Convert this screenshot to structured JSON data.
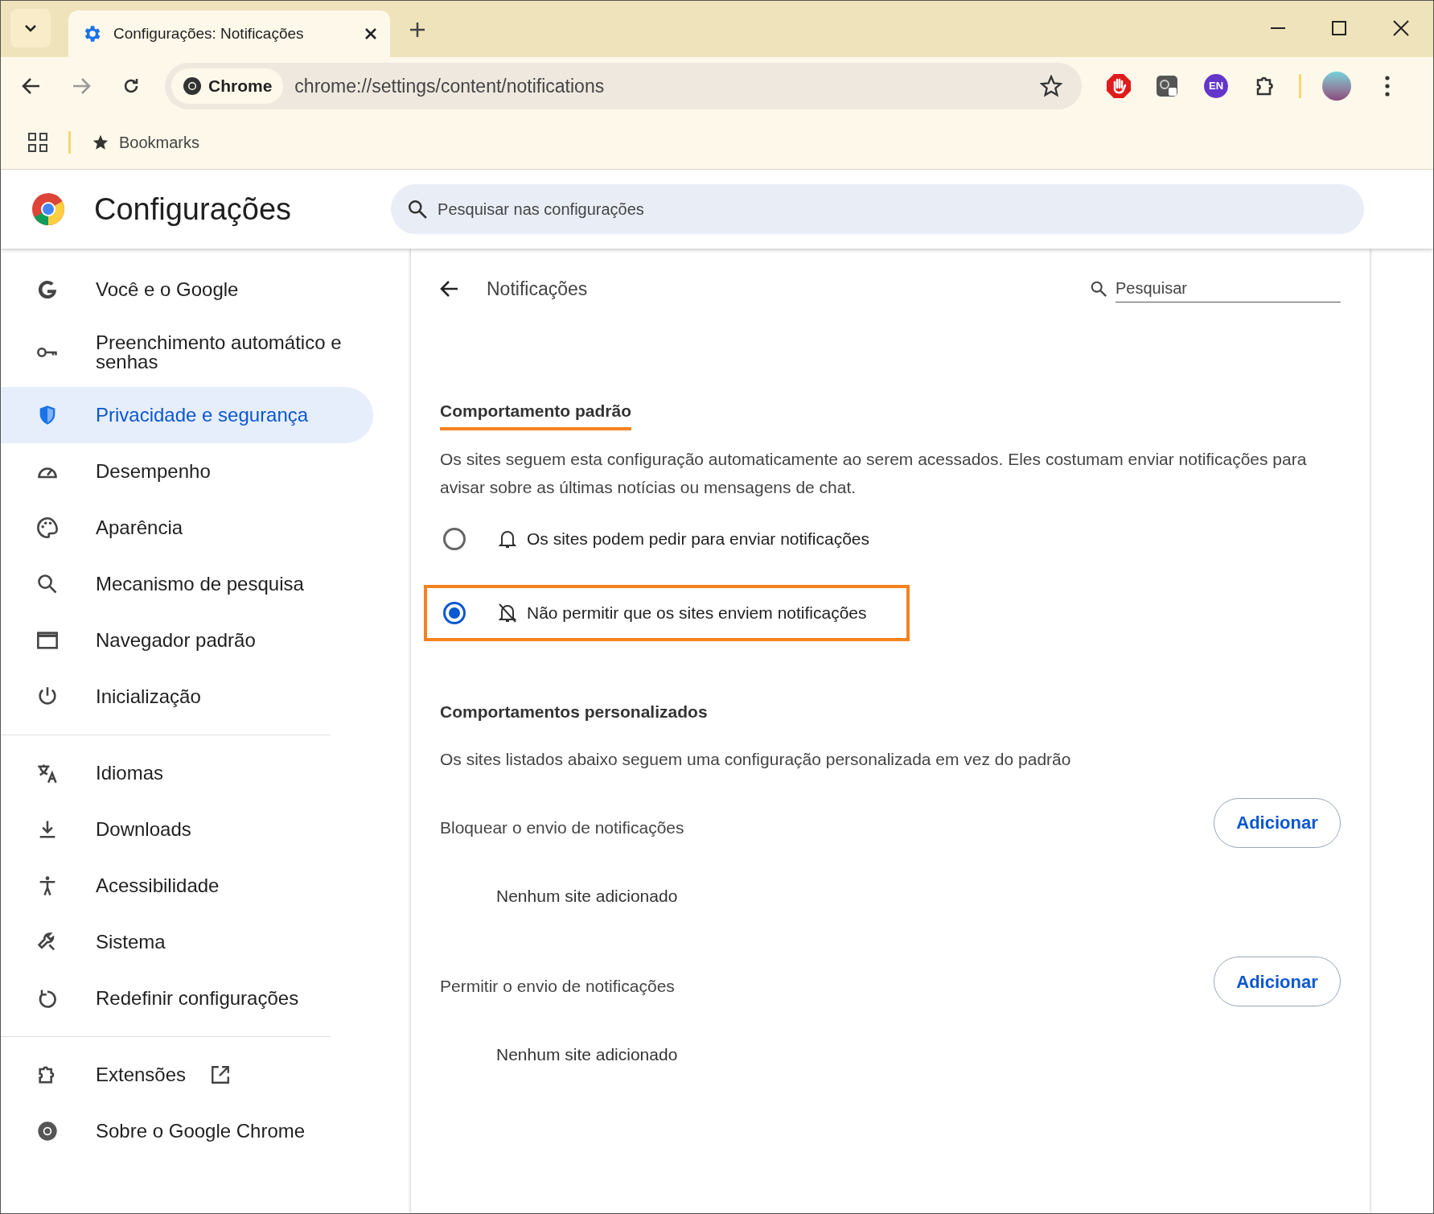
{
  "browser": {
    "tab": {
      "title": "Configurações: Notificações",
      "selected": true
    },
    "address_chip": "Chrome",
    "url": "chrome://settings/content/notifications",
    "bookmarks_label": "Bookmarks",
    "extension_badge": "EN"
  },
  "header": {
    "title": "Configurações",
    "search_placeholder": "Pesquisar nas configurações"
  },
  "sidebar": {
    "groups": [
      [
        {
          "label": "Você e o Google",
          "kind": "google",
          "selected": false
        },
        {
          "label": "Preenchimento automático e senhas",
          "kind": "key",
          "selected": false
        },
        {
          "label": "Privacidade e segurança",
          "kind": "shield",
          "selected": true
        },
        {
          "label": "Desempenho",
          "kind": "gauge",
          "selected": false
        },
        {
          "label": "Aparência",
          "kind": "palette",
          "selected": false
        },
        {
          "label": "Mecanismo de pesquisa",
          "kind": "search",
          "selected": false
        },
        {
          "label": "Navegador padrão",
          "kind": "window",
          "selected": false
        },
        {
          "label": "Inicialização",
          "kind": "power",
          "selected": false
        }
      ],
      [
        {
          "label": "Idiomas",
          "kind": "translate",
          "selected": false
        },
        {
          "label": "Downloads",
          "kind": "download",
          "selected": false
        },
        {
          "label": "Acessibilidade",
          "kind": "accessibility",
          "selected": false
        },
        {
          "label": "Sistema",
          "kind": "wrench",
          "selected": false
        },
        {
          "label": "Redefinir configurações",
          "kind": "reset",
          "selected": false
        }
      ],
      [
        {
          "label": "Extensões",
          "kind": "puzzle",
          "selected": false,
          "external": true
        },
        {
          "label": "Sobre o Google Chrome",
          "kind": "chrome",
          "selected": false
        }
      ]
    ]
  },
  "page": {
    "title": "Notificações",
    "search_placeholder": "Pesquisar",
    "default_section": {
      "heading": "Comportamento padrão",
      "heading_underlined": true,
      "description": "Os sites seguem esta configuração automaticamente ao serem acessados. Eles costumam enviar notificações para avisar sobre as últimas notícias ou mensagens de chat.",
      "options": [
        {
          "label": "Os sites podem pedir para enviar notificações",
          "kind": "bell",
          "selected": false,
          "highlighted": false
        },
        {
          "label": "Não permitir que os sites enviem notificações",
          "kind": "bell-off",
          "selected": true,
          "highlighted": true
        }
      ]
    },
    "custom_section": {
      "heading": "Comportamentos personalizados",
      "description": "Os sites listados abaixo seguem uma configuração personalizada em vez do padrão",
      "lists": [
        {
          "title": "Bloquear o envio de notificações",
          "button": "Adicionar",
          "empty": "Nenhum site adicionado"
        },
        {
          "title": "Permitir o envio de notificações",
          "button": "Adicionar",
          "empty": "Nenhum site adicionado"
        }
      ]
    }
  }
}
